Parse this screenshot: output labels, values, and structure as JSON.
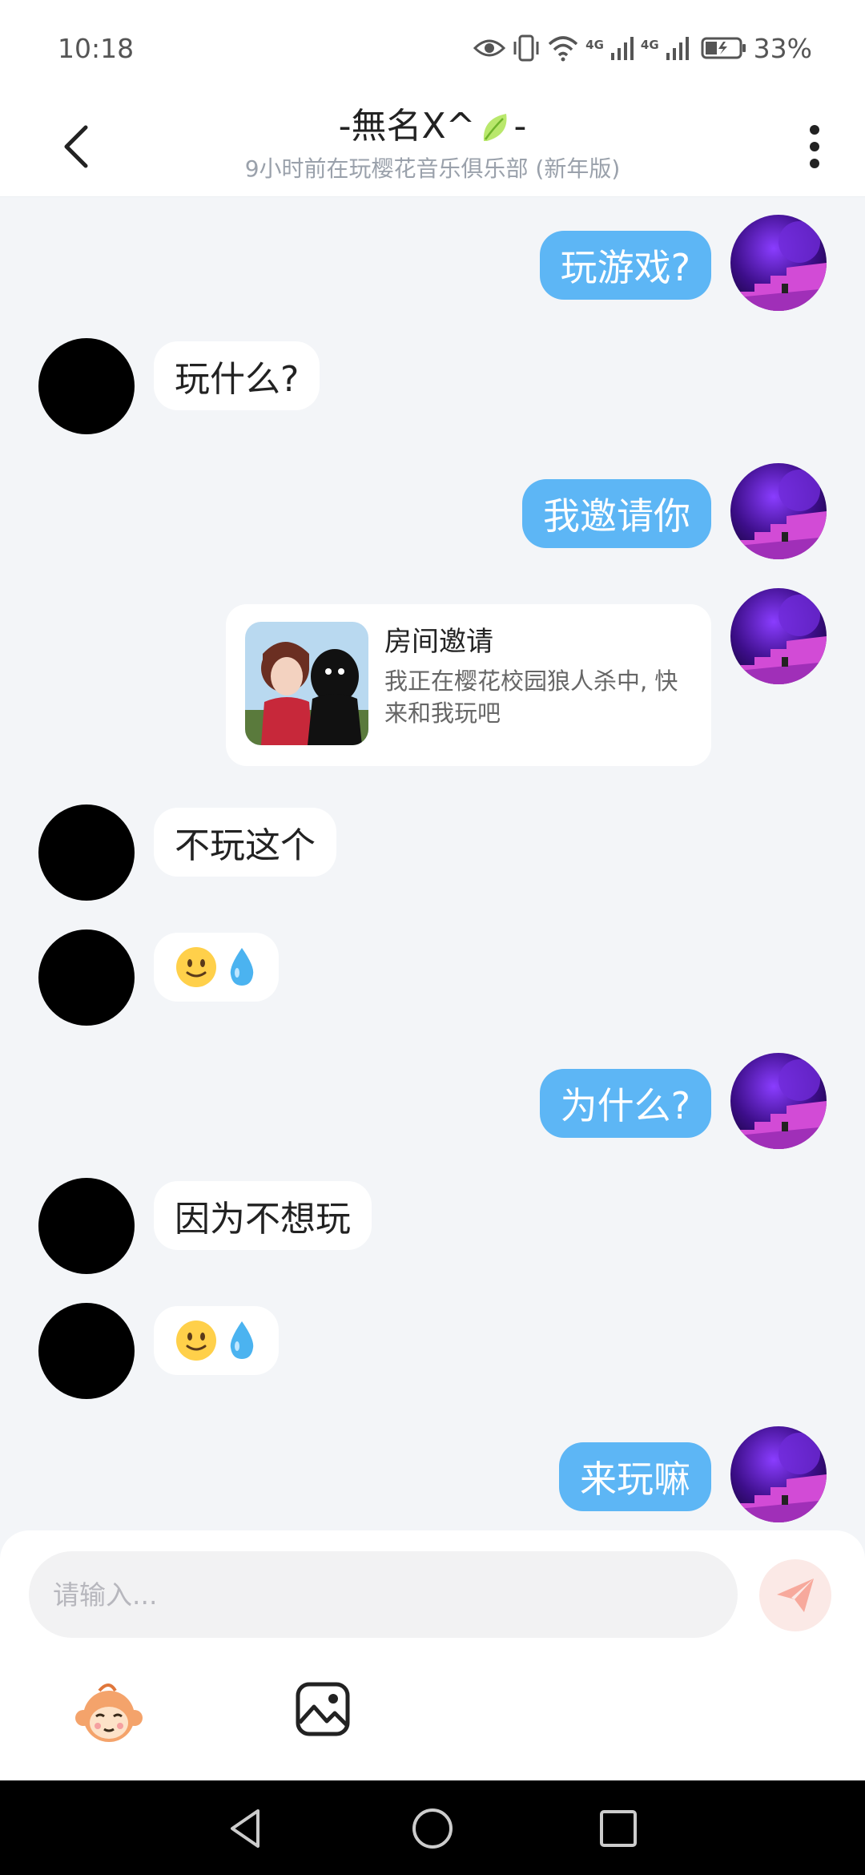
{
  "status_bar": {
    "time": "10:18",
    "network_label_1": "4G",
    "network_label_2": "4G",
    "battery_percent": "33%",
    "icons": [
      "eye-icon",
      "vibrate-icon",
      "wifi-icon",
      "signal-icon",
      "battery-icon"
    ]
  },
  "header": {
    "title_left": "-無名X^",
    "title_right": "-",
    "subtitle": "9小时前在玩樱花音乐俱乐部 (新年版)",
    "back_icon": "chevron-left-icon",
    "more_icon": "more-vertical-icon"
  },
  "messages": [
    {
      "from": "self",
      "text": "玩游戏?"
    },
    {
      "from": "other",
      "text": "玩什么?"
    },
    {
      "from": "self",
      "text": "我邀请你"
    },
    {
      "from": "self",
      "type": "room_invite",
      "title": "房间邀请",
      "desc_line1": "我正在樱花校园狼人杀中, 快",
      "desc_line2": "来和我玩吧"
    },
    {
      "from": "other",
      "text": "不玩这个"
    },
    {
      "from": "other",
      "type": "emoji",
      "text": "🙂💧"
    },
    {
      "from": "self",
      "text": "为什么?"
    },
    {
      "from": "other",
      "text": "因为不想玩"
    },
    {
      "from": "other",
      "type": "emoji",
      "text": "🙂💧"
    },
    {
      "from": "self",
      "text": "来玩嘛"
    }
  ],
  "input": {
    "placeholder": "请输入...",
    "value": ""
  },
  "colors": {
    "self_bubble": "#5db6f5",
    "other_bubble": "#ffffff",
    "background": "#f3f5f8",
    "send_button": "#fbe9e6",
    "send_icon": "#f7a99c"
  }
}
